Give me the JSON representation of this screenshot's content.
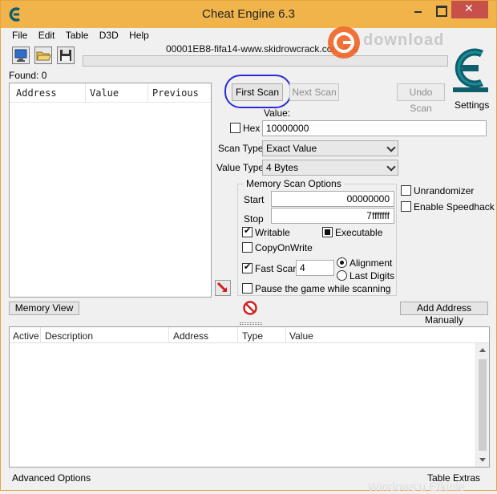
{
  "window": {
    "title": "Cheat Engine 6.3",
    "titlebar_color": "#f0b44b",
    "close_color": "#c7504a"
  },
  "menu": [
    "File",
    "Edit",
    "Table",
    "D3D",
    "Help"
  ],
  "toolbar": {
    "open_process_icon": "computer-monitor-icon",
    "open_file_icon": "folder-open-icon",
    "save_icon": "floppy-disk-icon"
  },
  "process_name": "00001EB8-fifa14-www.skidrowcrack.com.exe",
  "watermark_text": "download",
  "watermark_bottom": "Windows'u Etkinle",
  "settings_label": "Settings",
  "found_label": "Found: 0",
  "result_list": {
    "columns": [
      "Address",
      "Value",
      "Previous"
    ]
  },
  "scan": {
    "first_scan": "First Scan",
    "next_scan": "Next Scan",
    "undo_scan": "Undo Scan",
    "value_label": "Value:",
    "hex_label": "Hex",
    "value": "10000000",
    "scan_type_label": "Scan Type",
    "scan_type": "Exact Value",
    "value_type_label": "Value Type",
    "value_type": "4 Bytes"
  },
  "memory_options": {
    "title": "Memory Scan Options",
    "start_label": "Start",
    "start": "00000000",
    "stop_label": "Stop",
    "stop": "7fffffff",
    "writable": "Writable",
    "executable": "Executable",
    "copy_on_write": "CopyOnWrite",
    "fast_scan": "Fast Scan",
    "fast_scan_value": "4",
    "alignment": "Alignment",
    "last_digits": "Last Digits",
    "pause_game": "Pause the game while scanning"
  },
  "extra_options": {
    "unrandomizer": "Unrandomizer",
    "speedhack": "Enable Speedhack"
  },
  "buttons": {
    "memory_view": "Memory View",
    "add_address": "Add Address Manually"
  },
  "address_list": {
    "columns": [
      "Active",
      "Description",
      "Address",
      "Type",
      "Value"
    ]
  },
  "status": {
    "advanced_options": "Advanced Options",
    "table_extras": "Table Extras"
  },
  "colors": {
    "highlight_circle": "#2b2bd9",
    "stop_icon": "#d01e1e",
    "logo": "#0d5f6b"
  }
}
